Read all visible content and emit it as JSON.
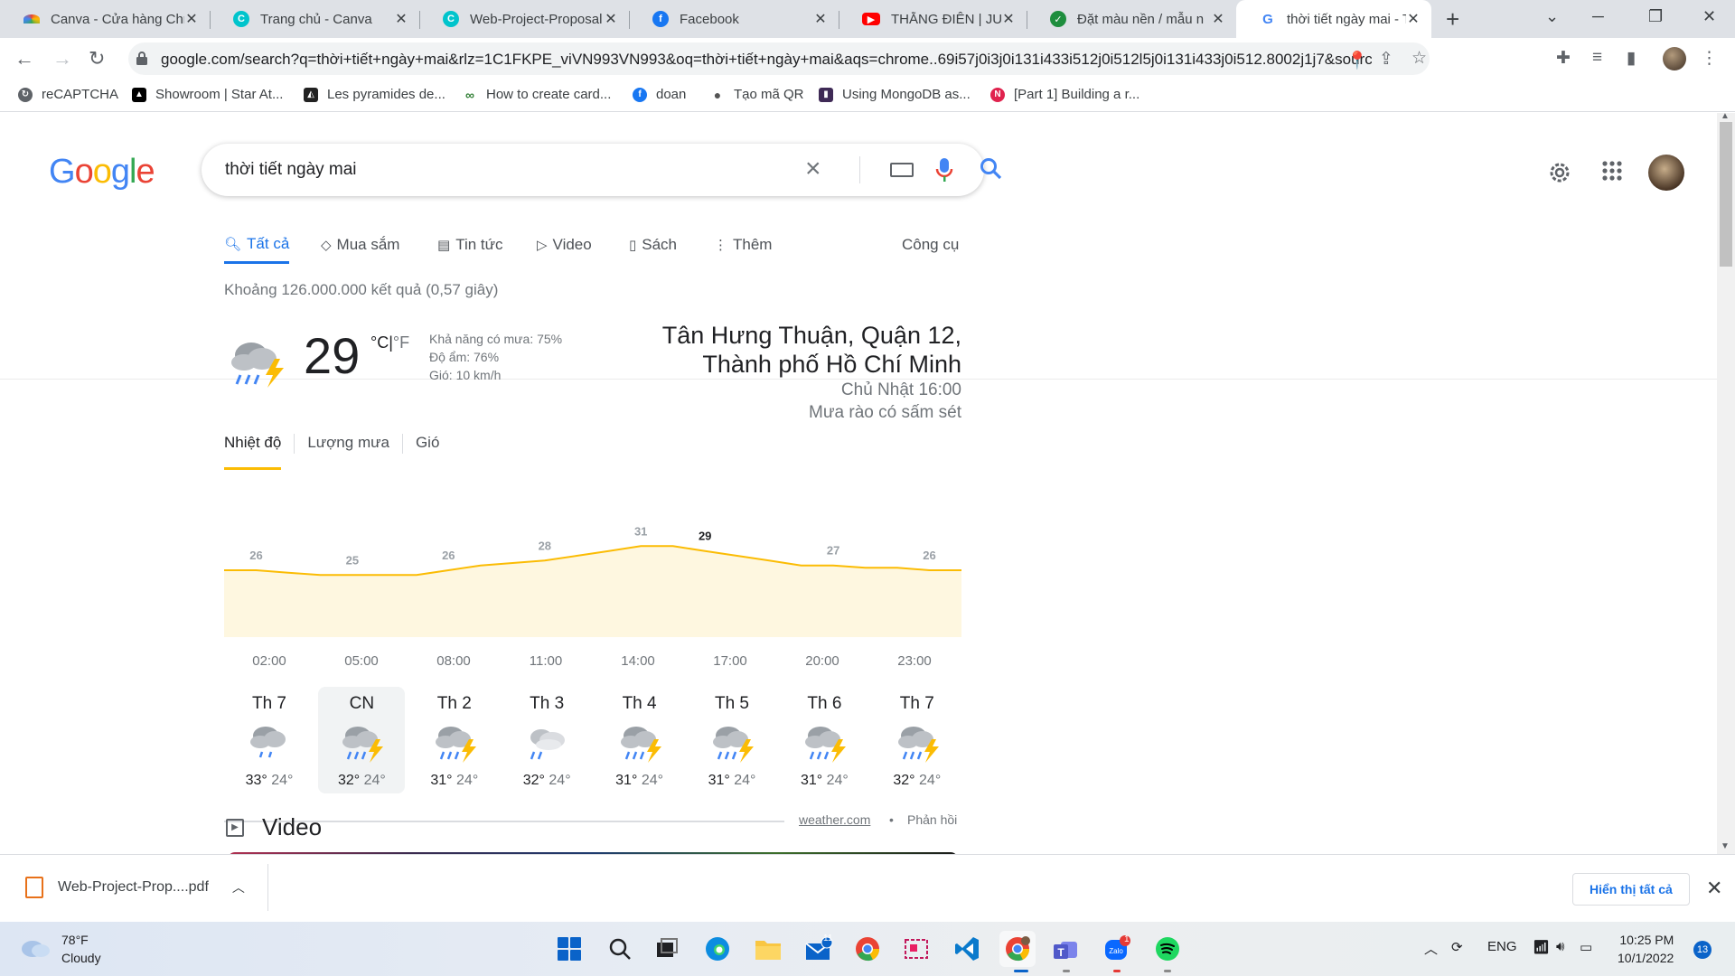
{
  "browser": {
    "tabs": [
      {
        "title": "Canva - Cửa hàng Chr",
        "icon": "canva-rainbow-icon",
        "color": "#f4b400"
      },
      {
        "title": "Trang chủ - Canva",
        "icon": "canva-icon",
        "color": "#00c4cc"
      },
      {
        "title": "Web-Project-Proposal",
        "icon": "canva-icon",
        "color": "#00c4cc"
      },
      {
        "title": "Facebook",
        "icon": "facebook-icon",
        "color": "#1877f2"
      },
      {
        "title": "THẰNG ĐIÊN | JUSTAT",
        "icon": "youtube-icon",
        "color": "#ff0000"
      },
      {
        "title": "Đặt màu nền / mẫu n",
        "icon": "leaf-icon",
        "color": "#1e8e3e"
      },
      {
        "title": "thời tiết ngày mai - Tì",
        "icon": "google-icon",
        "color": "#4285f4"
      }
    ],
    "url_domain": "google.com",
    "url_rest": "/search?q=thời+tiết+ngày+mai&rlz=1C1FKPE_viVN993VN993&oq=thời+tiết+ngày+mai&aqs=chrome..69i57j0i3j0i131i433i512j0i512l5j0i131i433j0i512.8002j1j7&sourc...",
    "bookmarks": [
      {
        "label": "reCAPTCHA",
        "icon": "recaptcha-icon",
        "color": "#5f6368"
      },
      {
        "label": "Showroom | Star At...",
        "icon": "star-at-icon",
        "color": "#000000"
      },
      {
        "label": "Les pyramides de...",
        "icon": "pyramid-icon",
        "color": "#222222"
      },
      {
        "label": "How to create card...",
        "icon": "link-icon",
        "color": "#2e7d32"
      },
      {
        "label": "doan",
        "icon": "facebook-icon",
        "color": "#1877f2"
      },
      {
        "label": "Tạo mã QR",
        "icon": "apple-icon",
        "color": "#555555"
      },
      {
        "label": "Using MongoDB as...",
        "icon": "mongodb-icon",
        "color": "#3f2a56"
      },
      {
        "label": "[Part 1] Building a r...",
        "icon": "nest-icon",
        "color": "#e0234e"
      }
    ]
  },
  "search": {
    "query": "thời tiết ngày mai",
    "tabs": [
      "Tất cả",
      "Mua sắm",
      "Tin tức",
      "Video",
      "Sách",
      "Thêm"
    ],
    "tools": "Công cụ",
    "stats": "Khoảng 126.000.000 kết quả (0,57 giây)"
  },
  "weather": {
    "temperature": "29",
    "unit_c": "°C",
    "unit_sep": "|",
    "unit_f": "°F",
    "precip": "Khả năng có mưa: 75%",
    "humidity": "Độ ẩm: 76%",
    "wind": "Gió: 10 km/h",
    "location_line1": "Tân Hưng Thuận, Quận 12,",
    "location_line2": "Thành phố Hồ Chí Minh",
    "time": "Chủ Nhật 16:00",
    "condition": "Mưa rào có sấm sét",
    "tabs": [
      "Nhiệt độ",
      "Lượng mưa",
      "Gió"
    ],
    "hours": [
      "02:00",
      "05:00",
      "08:00",
      "11:00",
      "14:00",
      "17:00",
      "20:00",
      "23:00"
    ],
    "days": [
      {
        "name": "Th 7",
        "hi": "33°",
        "lo": "24°",
        "icon": "rain-cloud-icon"
      },
      {
        "name": "CN",
        "hi": "32°",
        "lo": "24°",
        "icon": "thunderstorm-icon"
      },
      {
        "name": "Th 2",
        "hi": "31°",
        "lo": "24°",
        "icon": "thunderstorm-icon"
      },
      {
        "name": "Th 3",
        "hi": "32°",
        "lo": "24°",
        "icon": "partly-rain-icon"
      },
      {
        "name": "Th 4",
        "hi": "31°",
        "lo": "24°",
        "icon": "thunderstorm-icon"
      },
      {
        "name": "Th 5",
        "hi": "31°",
        "lo": "24°",
        "icon": "thunderstorm-icon"
      },
      {
        "name": "Th 6",
        "hi": "31°",
        "lo": "24°",
        "icon": "thunderstorm-icon"
      },
      {
        "name": "Th 7",
        "hi": "32°",
        "lo": "24°",
        "icon": "thunderstorm-icon"
      }
    ],
    "source": "weather.com",
    "feedback": "Phản hồi",
    "accent": "#fbbc04"
  },
  "chart_data": {
    "type": "area",
    "x": [
      "01:00",
      "02:00",
      "03:00",
      "04:00",
      "05:00",
      "06:00",
      "07:00",
      "08:00",
      "09:00",
      "10:00",
      "11:00",
      "12:00",
      "13:00",
      "14:00",
      "15:00",
      "16:00",
      "17:00",
      "18:00",
      "19:00",
      "20:00",
      "21:00",
      "22:00",
      "23:00",
      "00:00"
    ],
    "values": [
      26,
      26,
      25.5,
      25,
      25,
      25,
      25,
      26,
      27,
      27.5,
      28,
      29,
      30,
      31,
      31,
      30,
      29,
      28,
      27,
      27,
      26.5,
      26.5,
      26,
      26
    ],
    "labels": [
      {
        "x": "02:00",
        "text": "26"
      },
      {
        "x": "05:00",
        "text": "25"
      },
      {
        "x": "08:00",
        "text": "26"
      },
      {
        "x": "11:00",
        "text": "28"
      },
      {
        "x": "14:00",
        "text": "31"
      },
      {
        "x": "16:00",
        "text": "29"
      },
      {
        "x": "20:00",
        "text": "27"
      },
      {
        "x": "23:00",
        "text": "26"
      }
    ],
    "ylim": [
      20,
      35
    ],
    "line_color": "#fbbc04",
    "fill_color": "#fef7e0"
  },
  "video_section": {
    "title": "Video"
  },
  "download": {
    "filename": "Web-Project-Prop....pdf",
    "show_all": "Hiển thị tất cả"
  },
  "taskbar": {
    "weather_temp": "78°F",
    "weather_cond": "Cloudy",
    "mail_badge": "11",
    "zalo_badge": "1",
    "lang": "ENG",
    "time": "10:25 PM",
    "date": "10/1/2022",
    "notifications": "13"
  }
}
